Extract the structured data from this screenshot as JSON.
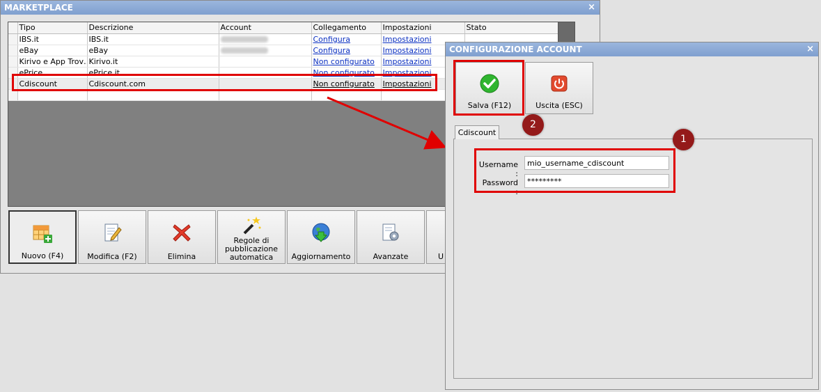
{
  "marketplace": {
    "title": "MARKETPLACE",
    "close": "×",
    "columns": [
      "Tipo",
      "Descrizione",
      "Account",
      "Collegamento",
      "Impostazioni",
      "Stato"
    ],
    "rows": [
      {
        "tipo": "IBS.it",
        "descrizione": "IBS.it",
        "collegamento": "Configura",
        "impostazioni": "Impostazioni"
      },
      {
        "tipo": "eBay",
        "descrizione": "eBay",
        "collegamento": "Configura",
        "impostazioni": "Impostazioni"
      },
      {
        "tipo": "Kirivo e App Trov…",
        "descrizione": "Kirivo.it",
        "collegamento": "Non configurato",
        "impostazioni": "Impostazioni"
      },
      {
        "tipo": "ePrice",
        "descrizione": "ePrice.it",
        "collegamento": "Non configurato",
        "impostazioni": "Impostazioni"
      },
      {
        "tipo": "Cdiscount",
        "descrizione": "Cdiscount.com",
        "collegamento": "Non configurato",
        "impostazioni": "Impostazioni"
      }
    ],
    "toolbar": {
      "nuovo": "Nuovo (F4)",
      "modifica": "Modifica (F2)",
      "elimina": "Elimina",
      "regole": "Regole di pubblicazione automatica",
      "aggiornamento": "Aggiornamento",
      "avanzate": "Avanzate",
      "uscita_partial": "U"
    }
  },
  "config": {
    "title": "CONFIGURAZIONE ACCOUNT",
    "close": "×",
    "salva": "Salva (F12)",
    "uscita": "Uscita (ESC)",
    "tab": "Cdiscount",
    "username_label": "Username :",
    "username_value": "mio_username_cdiscount",
    "password_label": "Password :",
    "password_value": "*********"
  },
  "badges": {
    "one": "1",
    "two": "2"
  },
  "colors": {
    "titlebar": "#8aa8d6",
    "highlight": "#e00000",
    "badge": "#941a1a",
    "link": "#0a2fc0"
  }
}
